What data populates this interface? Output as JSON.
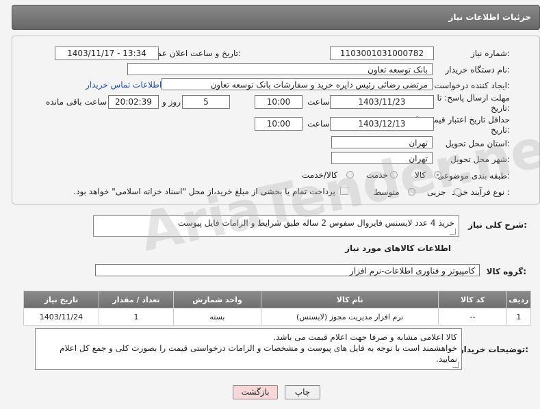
{
  "header": {
    "title": "جزئیات اطلاعات نیاز"
  },
  "form": {
    "need_number_label": "شماره نیاز:",
    "need_number": "1103001031000782",
    "announce_label": "تاریخ و ساعت اعلان عمومی:",
    "announce_value": "1403/11/17 - 13:34",
    "buyer_org_label": "نام دستگاه خریدار:",
    "buyer_org": "بانک توسعه تعاون",
    "creator_label": "ایجاد کننده درخواست:",
    "creator": "مرتضی رضائی رئیس دایره خرید و سفارشات بانک توسعه تعاون",
    "contact_link": "اطلاعات تماس خریدار",
    "deadline_label_1": "مهلت ارسال پاسخ: تا",
    "deadline_label_2": "تاریخ:",
    "deadline_date": "1403/11/23",
    "time_label": "ساعت",
    "deadline_time": "10:00",
    "days_value": "5",
    "days_label": "روز و",
    "remaining_time": "20:02:39",
    "remaining_label": "ساعت باقی مانده",
    "validity_label_1": "حداقل تاریخ اعتبار قیمت: تا",
    "validity_label_2": "تاریخ:",
    "validity_date": "1403/12/13",
    "validity_time": "10:00",
    "province_label": "استان محل تحویل:",
    "province": "تهران",
    "city_label": "شهر محل تحویل:",
    "city": "تهران",
    "category_label": "طبقه بندی موضوعی:",
    "category_options": [
      "کالا",
      "خدمت",
      "کالا/خدمت"
    ],
    "process_label": "نوع فرآیند خرید :",
    "process_options": [
      "جزیی",
      "متوسط"
    ],
    "payment_note": "پرداخت تمام یا بخشی از مبلغ خرید،از محل \"اسناد خزانه اسلامی\" خواهد بود."
  },
  "description": {
    "label": "شرح کلی نیاز:",
    "text": "خرید 4 عدد لایسنس فایروال سفوس 2 ساله طبق شرایط و الزامات فایل پیوست"
  },
  "goods": {
    "section_title": "اطلاعات کالاهای مورد نیاز",
    "group_label": "گروه کالا:",
    "group_value": "کامپیوتر و فناوری اطلاعات-نرم افزار",
    "columns": [
      "ردیف",
      "کد کالا",
      "نام کالا",
      "واحد شمارش",
      "تعداد / مقدار",
      "تاریخ نیاز"
    ],
    "rows": [
      [
        "1",
        "--",
        "نرم افزار مدیریت مجوز (لایسنس)",
        "بسته",
        "1",
        "1403/11/24"
      ]
    ]
  },
  "buyer_notes": {
    "label": "توضیحات خریدار:",
    "line1": "کالا اعلامی مشابه و صرفا جهت اعلام قیمت می باشد.",
    "line2": "خواهشمند است با توجه به فایل های پیوست و مشخصات و الزامات درخواستی قیمت را بصورت کلی و جمع کل اعلام نمایید."
  },
  "buttons": {
    "print": "چاپ",
    "back": "بازگشت"
  },
  "watermark": "AriaTender.net"
}
